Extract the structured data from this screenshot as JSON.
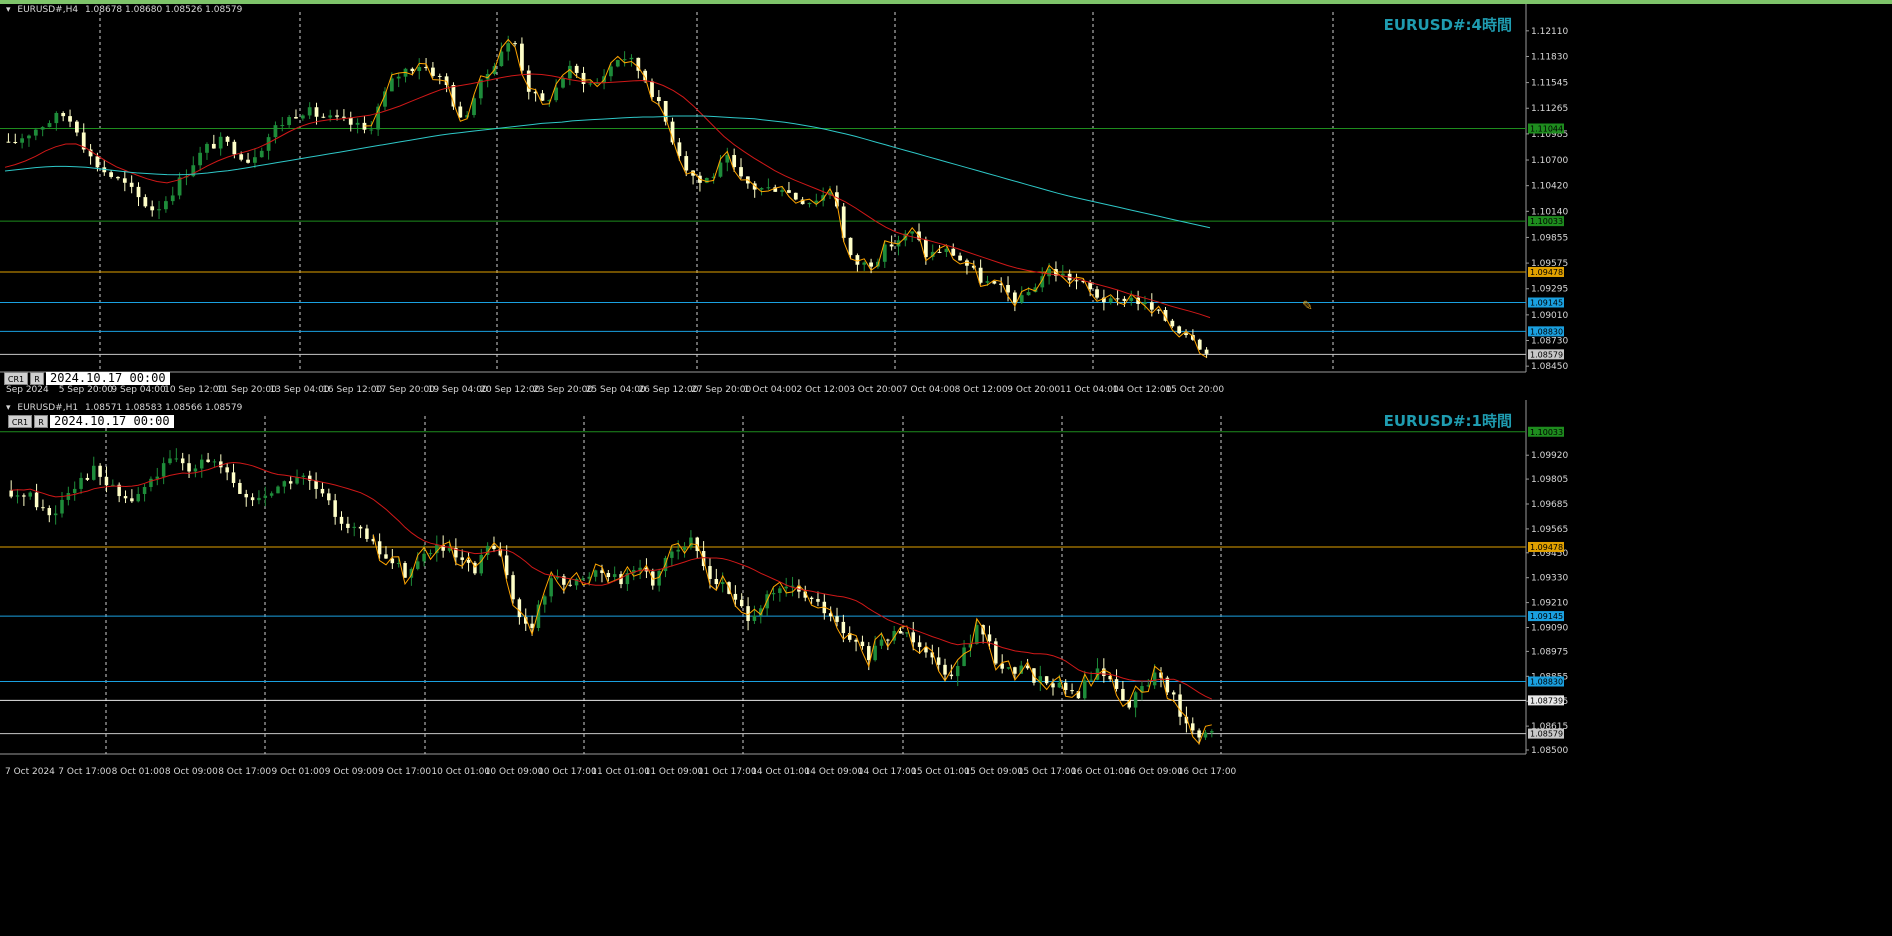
{
  "top_chart": {
    "header": {
      "symbol_tf": "EURUSD#,H4",
      "ohlc": "1.08678 1.08680 1.08526 1.08579"
    },
    "watermark": "EURUSD#:4時間",
    "date_label": "2024.10.17 00:00",
    "buttons": [
      "CR1",
      "R"
    ]
  },
  "bottom_chart": {
    "header": {
      "symbol_tf": "EURUSD#,H1",
      "ohlc": "1.08571 1.08583 1.08566 1.08579"
    },
    "watermark": "EURUSD#:1時間",
    "date_label": "2024.10.17 00:00",
    "buttons": [
      "CR1",
      "R"
    ]
  },
  "colors": {
    "up": "#1e8c3a",
    "down": "#ffffc8",
    "ma_red": "#d01818",
    "ma_cyan": "#2ec8c8",
    "zigzag": "#ffa500",
    "grid": "#cfcfcf",
    "axis_text": "#d8d8d8"
  },
  "chart_data": [
    {
      "type": "candlestick",
      "title": "EURUSD#,H4",
      "ylim": [
        1.0843,
        1.1225
      ],
      "y_ticks": [
        "1.12110",
        "1.11830",
        "1.11545",
        "1.11265",
        "1.10985",
        "1.10700",
        "1.10420",
        "1.10140",
        "1.09855",
        "1.09575",
        "1.09295",
        "1.09010",
        "1.08730",
        "1.08450"
      ],
      "x_labels": [
        "Sep 2024",
        "5 Sep 20:00",
        "9 Sep 04:00",
        "10 Sep 12:00",
        "11 Sep 20:00",
        "13 Sep 04:00",
        "16 Sep 12:00",
        "17 Sep 20:00",
        "19 Sep 04:00",
        "20 Sep 12:00",
        "23 Sep 20:00",
        "25 Sep 04:00",
        "26 Sep 12:00",
        "27 Sep 20:00",
        "1 Oct 04:00",
        "2 Oct 12:00",
        "3 Oct 20:00",
        "7 Oct 04:00",
        "8 Oct 12:00",
        "9 Oct 20:00",
        "11 Oct 04:00",
        "14 Oct 12:00",
        "15 Oct 20:00"
      ],
      "horizontal_lines": [
        {
          "value": 1.11044,
          "label": "1.11044",
          "color": "#1e8c1e"
        },
        {
          "value": 1.10033,
          "label": "1.10033",
          "color": "#1e8c1e"
        },
        {
          "value": 1.09478,
          "label": "1.09478",
          "color": "#e0a000"
        },
        {
          "value": 1.09145,
          "label": "1.09145",
          "color": "#1aa0e0"
        },
        {
          "value": 1.0883,
          "label": "1.08830",
          "color": "#1aa0e0"
        },
        {
          "value": 1.08579,
          "label": "1.08579",
          "color": "#c8c8c8"
        }
      ],
      "close_path": [
        1.1085,
        1.1095,
        1.1104,
        1.1112,
        1.112,
        1.111,
        1.1075,
        1.106,
        1.105,
        1.104,
        1.1025,
        1.1015,
        1.103,
        1.105,
        1.107,
        1.1085,
        1.109,
        1.1082,
        1.107,
        1.1085,
        1.1105,
        1.1115,
        1.1125,
        1.112,
        1.1115,
        1.1112,
        1.1108,
        1.11,
        1.1135,
        1.116,
        1.117,
        1.1175,
        1.1165,
        1.115,
        1.111,
        1.114,
        1.1165,
        1.119,
        1.12,
        1.115,
        1.113,
        1.1145,
        1.117,
        1.116,
        1.115,
        1.1168,
        1.1185,
        1.1175,
        1.1155,
        1.1125,
        1.109,
        1.106,
        1.1045,
        1.1055,
        1.107,
        1.1048,
        1.104,
        1.1038,
        1.1042,
        1.103,
        1.1025,
        1.103,
        1.104,
        1.0965,
        1.0955,
        1.096,
        1.0975,
        1.0985,
        1.099,
        1.0965,
        1.0972,
        1.0968,
        1.0955,
        1.094,
        1.0932,
        1.0925,
        1.0915,
        1.0932,
        1.095,
        1.0945,
        1.094,
        1.093,
        1.092,
        1.0912,
        1.0922,
        1.0915,
        1.0905,
        1.0895,
        1.0885,
        1.0879,
        1.0858
      ],
      "ma_red_path": [
        1.1062,
        1.1066,
        1.1072,
        1.108,
        1.1086,
        1.1089,
        1.1083,
        1.1073,
        1.1064,
        1.1058,
        1.1052,
        1.1047,
        1.1045,
        1.1049,
        1.1056,
        1.1064,
        1.1071,
        1.1076,
        1.108,
        1.1085,
        1.1093,
        1.1101,
        1.1108,
        1.1112,
        1.1114,
        1.1115,
        1.1117,
        1.1119,
        1.1123,
        1.1128,
        1.1134,
        1.114,
        1.1146,
        1.115,
        1.1152,
        1.1155,
        1.1158,
        1.1161,
        1.1163,
        1.1164,
        1.1163,
        1.116,
        1.1157,
        1.1155,
        1.1154,
        1.1155,
        1.1156,
        1.1157,
        1.1155,
        1.1149,
        1.114,
        1.1127,
        1.1112,
        1.1097,
        1.1085,
        1.1075,
        1.1066,
        1.1057,
        1.105,
        1.1044,
        1.1038,
        1.1032,
        1.1025,
        1.1016,
        1.1006,
        1.0997,
        1.099,
        1.0986,
        1.0983,
        1.0979,
        1.0975,
        1.097,
        1.0965,
        1.096,
        1.0955,
        1.0951,
        1.0948,
        1.0946,
        1.0944,
        1.0941,
        1.0937,
        1.0933,
        1.0929,
        1.0924,
        1.092,
        1.0916,
        1.0911,
        1.0907,
        1.0903,
        1.0898
      ],
      "ma_cyan_path": [
        1.1058,
        1.106,
        1.1062,
        1.1063,
        1.1063,
        1.1062,
        1.106,
        1.1058,
        1.1056,
        1.1055,
        1.1054,
        1.1054,
        1.1055,
        1.1057,
        1.1059,
        1.1062,
        1.1065,
        1.1068,
        1.1071,
        1.1074,
        1.1077,
        1.108,
        1.1083,
        1.1086,
        1.1089,
        1.1092,
        1.1095,
        1.1098,
        1.11,
        1.1102,
        1.1104,
        1.1106,
        1.1108,
        1.111,
        1.1111,
        1.1113,
        1.1114,
        1.1115,
        1.1116,
        1.1117,
        1.1117,
        1.1118,
        1.1118,
        1.1118,
        1.1117,
        1.1116,
        1.1115,
        1.1113,
        1.1111,
        1.1108,
        1.1105,
        1.1101,
        1.1097,
        1.1092,
        1.1087,
        1.1082,
        1.1077,
        1.1072,
        1.1067,
        1.1062,
        1.1057,
        1.1052,
        1.1047,
        1.1042,
        1.1037,
        1.1032,
        1.1028,
        1.1024,
        1.102,
        1.1016,
        1.1012,
        1.1008,
        1.1004,
        1.1,
        1.0996
      ]
    },
    {
      "type": "candlestick",
      "title": "EURUSD#,H1",
      "ylim": [
        1.085,
        1.1008
      ],
      "y_ticks": [
        "1.09920",
        "1.09805",
        "1.09685",
        "1.09565",
        "1.09450",
        "1.09330",
        "1.09210",
        "1.09090",
        "1.08975",
        "1.08855",
        "1.08735",
        "1.08615",
        "1.08500"
      ],
      "x_labels": [
        "7 Oct 2024",
        "7 Oct 17:00",
        "8 Oct 01:00",
        "8 Oct 09:00",
        "8 Oct 17:00",
        "9 Oct 01:00",
        "9 Oct 09:00",
        "9 Oct 17:00",
        "10 Oct 01:00",
        "10 Oct 09:00",
        "10 Oct 17:00",
        "11 Oct 01:00",
        "11 Oct 09:00",
        "11 Oct 17:00",
        "14 Oct 01:00",
        "14 Oct 09:00",
        "14 Oct 17:00",
        "15 Oct 01:00",
        "15 Oct 09:00",
        "15 Oct 17:00",
        "16 Oct 01:00",
        "16 Oct 09:00",
        "16 Oct 17:00"
      ],
      "horizontal_lines": [
        {
          "value": 1.10033,
          "label": "1.10033",
          "color": "#1e8c1e"
        },
        {
          "value": 1.09478,
          "label": "1.09478",
          "color": "#e0a000"
        },
        {
          "value": 1.09145,
          "label": "1.09145",
          "color": "#1aa0e0"
        },
        {
          "value": 1.0883,
          "label": "1.08830",
          "color": "#1aa0e0"
        },
        {
          "value": 1.08739,
          "label": "1.08739",
          "color": "#e8e8e8"
        },
        {
          "value": 1.08579,
          "label": "1.08579",
          "color": "#c8c8c8"
        }
      ],
      "close_path": [
        1.097,
        1.0975,
        1.0968,
        1.0962,
        1.0975,
        1.098,
        1.0985,
        1.0978,
        1.0972,
        1.097,
        1.0978,
        1.0985,
        1.099,
        1.0985,
        1.0992,
        1.0988,
        1.098,
        1.0972,
        1.097,
        1.0975,
        1.0978,
        1.0982,
        1.0978,
        1.097,
        1.0962,
        1.0958,
        1.0952,
        1.0945,
        1.094,
        1.0935,
        1.0942,
        1.0948,
        1.0945,
        1.094,
        1.0935,
        1.095,
        1.094,
        1.092,
        1.0905,
        1.0925,
        1.0935,
        1.093,
        1.0932,
        1.0938,
        1.0935,
        1.0932,
        1.094,
        1.093,
        1.0945,
        1.0948,
        1.095,
        1.0935,
        1.093,
        1.0922,
        1.0915,
        1.092,
        1.0925,
        1.0928,
        1.0925,
        1.092,
        1.0915,
        1.0905,
        1.09,
        1.0895,
        1.0902,
        1.0908,
        1.0905,
        1.09,
        1.089,
        1.0888,
        1.09,
        1.091,
        1.0895,
        1.0888,
        1.089,
        1.0885,
        1.0883,
        1.088,
        1.0875,
        1.0885,
        1.0888,
        1.088,
        1.0872,
        1.088,
        1.0888,
        1.0878,
        1.0862,
        1.0855,
        1.0858
      ]
    }
  ]
}
